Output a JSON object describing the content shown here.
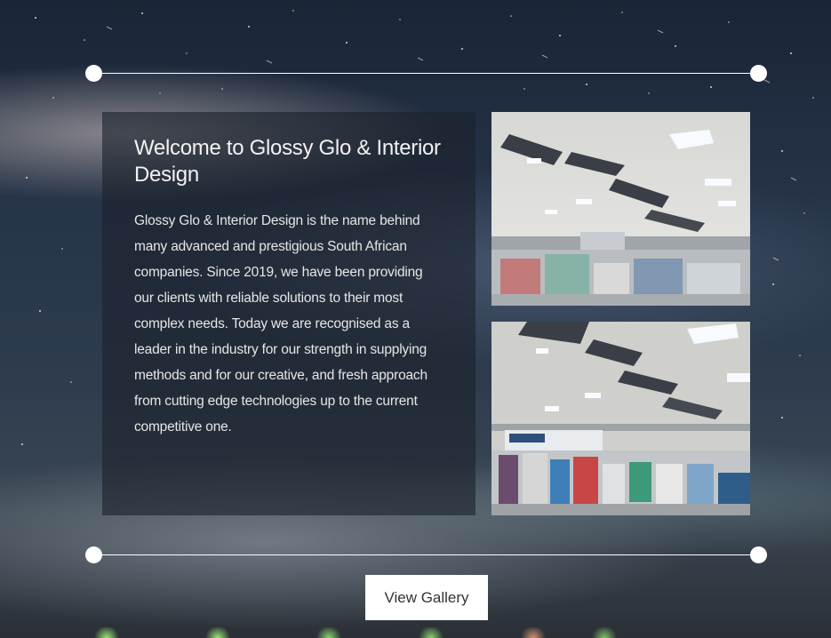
{
  "welcome": {
    "title": "Welcome to Glossy Glo & Interior Design",
    "body": "Glossy Glo & Interior Design is the name behind many advanced and prestigious South African companies. Since 2019, we have been providing our clients with reliable solutions to their most complex needs. Today we are recognised as a leader in the industry for our strength in supplying methods and for our creative, and fresh approach from cutting edge technologies up to the current competitive one."
  },
  "gallery_button": {
    "label": "View Gallery"
  },
  "colors": {
    "sky_dark": "#1a2536",
    "panel": "#1c222c",
    "divider": "#ffffff",
    "button_bg": "#ffffff",
    "button_text": "#333333"
  }
}
